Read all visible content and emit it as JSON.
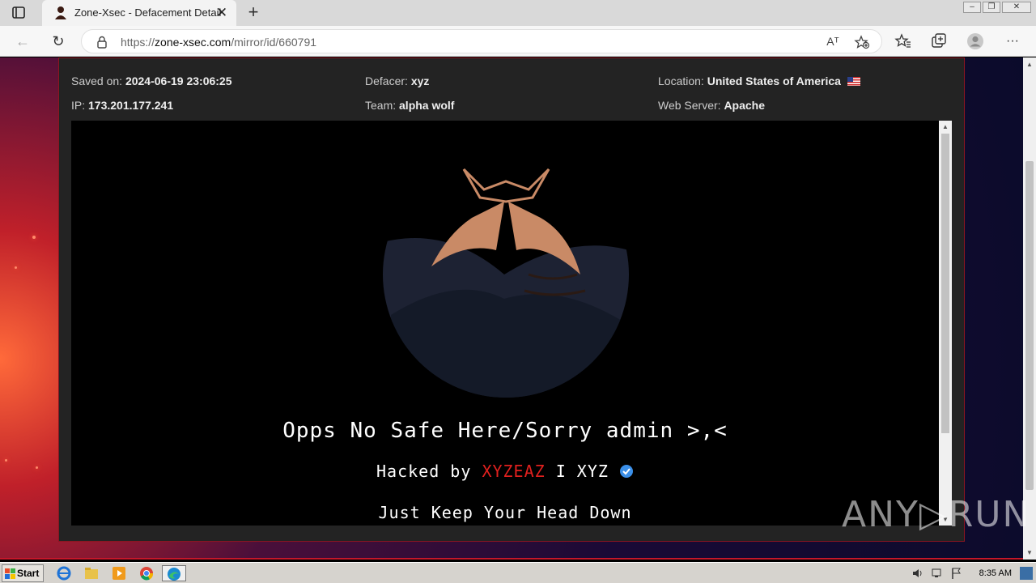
{
  "browser": {
    "tab_title": "Zone-Xsec - Defacement Detail",
    "url_prefix": "https://",
    "url_host": "zone-xsec.com",
    "url_path": "/mirror/id/660791",
    "read_aloud_label": "Aᵀ"
  },
  "details": {
    "saved_on_label": "Saved on:",
    "saved_on_value": "2024-06-19 23:06:25",
    "defacer_label": "Defacer:",
    "defacer_value": "xyz",
    "location_label": "Location:",
    "location_value": "United States of America",
    "ip_label": "IP:",
    "ip_value": "173.201.177.241",
    "team_label": "Team:",
    "team_value": "alpha wolf",
    "webserver_label": "Web Server:",
    "webserver_value": "Apache"
  },
  "mirror": {
    "line1": "Opps No Safe Here/Sorry admin >,<",
    "hacked_by": "Hacked by",
    "hacker_name": "XYZEAZ",
    "separator": " I XYZ",
    "line3": "Just Keep Your Head Down"
  },
  "watermark": "ANY▷RUN",
  "taskbar": {
    "start_label": "Start",
    "clock": "8:35 AM"
  },
  "colors": {
    "accent_red": "#e0201e",
    "panel_border": "#8b1620",
    "panel_bg": "#232323"
  },
  "icons": [
    "tab-list-icon",
    "favicon-icon",
    "close-icon",
    "plus-icon",
    "back-icon",
    "refresh-icon",
    "lock-icon",
    "read-aloud-icon",
    "add-favorite-icon",
    "favorites-icon",
    "collections-icon",
    "profile-icon",
    "more-icon",
    "us-flag-icon",
    "verified-icon",
    "windows-logo-icon",
    "ie-icon",
    "explorer-icon",
    "media-player-icon",
    "chrome-icon",
    "edge-icon",
    "volume-icon",
    "network-icon",
    "flag-icon"
  ]
}
